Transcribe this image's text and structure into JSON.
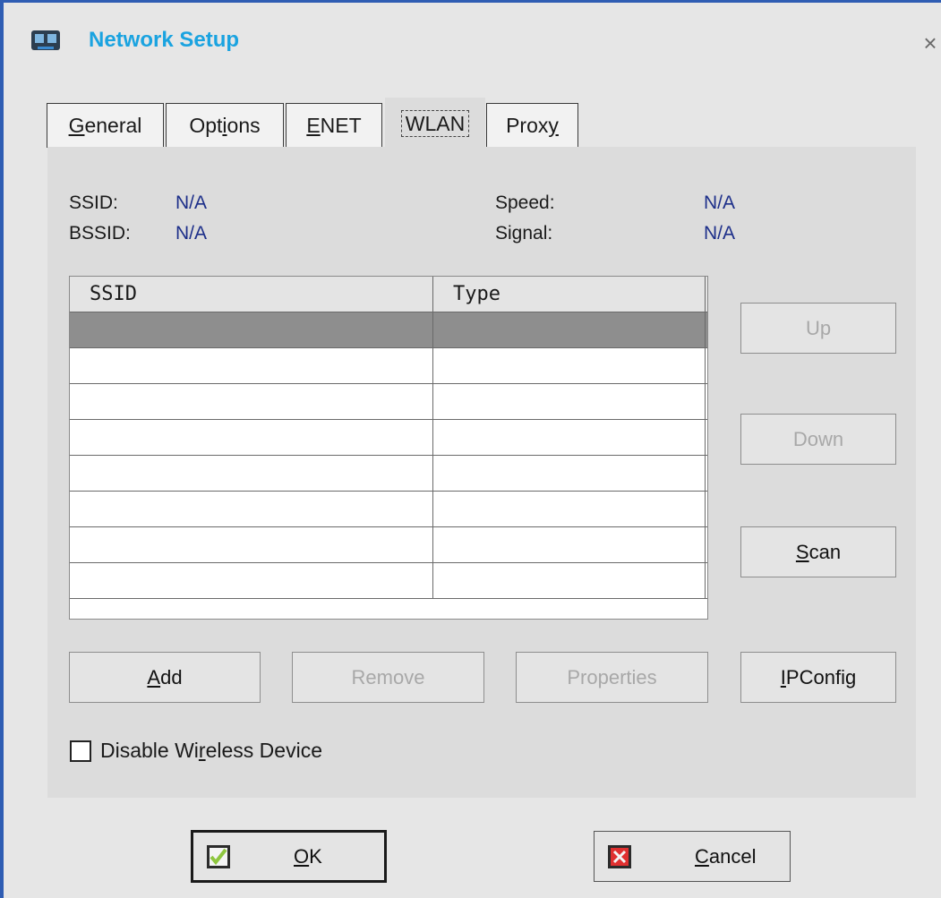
{
  "window": {
    "title": "Network Setup",
    "close_glyph": "×",
    "title_icon": "network-icon"
  },
  "tabs": [
    {
      "label": "General",
      "mnemonic_index": 0,
      "active": false
    },
    {
      "label": "Options",
      "mnemonic_index": 3,
      "active": false
    },
    {
      "label": "ENET",
      "mnemonic_index": 0,
      "active": false
    },
    {
      "label": "WLAN",
      "mnemonic_index": 0,
      "active": true
    },
    {
      "label": "Proxy",
      "mnemonic_index": 4,
      "active": false
    }
  ],
  "info": {
    "ssid_label": "SSID:",
    "ssid_value": "N/A",
    "bssid_label": "BSSID:",
    "bssid_value": "N/A",
    "speed_label": "Speed:",
    "speed_value": "N/A",
    "signal_label": "Signal:",
    "signal_value": "N/A"
  },
  "list": {
    "columns": [
      "SSID",
      "Type"
    ],
    "rows": [
      {
        "ssid": "",
        "type": "",
        "selected": true
      },
      {
        "ssid": "",
        "type": "",
        "selected": false
      },
      {
        "ssid": "",
        "type": "",
        "selected": false
      },
      {
        "ssid": "",
        "type": "",
        "selected": false
      },
      {
        "ssid": "",
        "type": "",
        "selected": false
      },
      {
        "ssid": "",
        "type": "",
        "selected": false
      },
      {
        "ssid": "",
        "type": "",
        "selected": false
      },
      {
        "ssid": "",
        "type": "",
        "selected": false
      }
    ]
  },
  "side_buttons": {
    "up": {
      "label": "Up",
      "enabled": false
    },
    "down": {
      "label": "Down",
      "enabled": false
    },
    "scan": {
      "label": "Scan",
      "mnemonic_index": 0,
      "enabled": true
    }
  },
  "bottom_buttons": {
    "add": {
      "label": "Add",
      "mnemonic_index": 0,
      "enabled": true
    },
    "remove": {
      "label": "Remove",
      "enabled": false
    },
    "properties": {
      "label": "Properties",
      "enabled": false
    },
    "ipconfig": {
      "label": "IPConfig",
      "mnemonic_index": 0,
      "enabled": true
    }
  },
  "disable_wireless": {
    "label": "Disable Wireless Device",
    "mnemonic_index": 10,
    "checked": false
  },
  "footer": {
    "ok": {
      "label": "OK",
      "mnemonic_index": 0,
      "icon": "check-icon"
    },
    "cancel": {
      "label": "Cancel",
      "mnemonic_index": 0,
      "icon": "x-icon"
    }
  },
  "colors": {
    "title": "#1aa3e0",
    "info_value": "#1d2f8a",
    "window_border": "#2f5db3",
    "selected_row": "#8e8e8e",
    "ok_icon": "#8ec63f",
    "cancel_icon": "#e03030"
  }
}
